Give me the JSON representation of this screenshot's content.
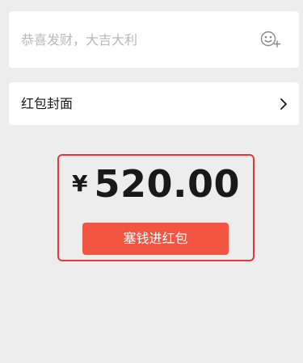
{
  "message": {
    "placeholder": "恭喜发财，大吉大利",
    "emoji_icon": "emoji-add-icon"
  },
  "cover": {
    "label": "红包封面",
    "chevron_icon": "chevron-right-icon"
  },
  "amount": {
    "currency": "¥",
    "value": "520.00"
  },
  "send_button": {
    "label": "塞钱进红包"
  },
  "colors": {
    "background": "#ededed",
    "card": "#ffffff",
    "button": "#f25542",
    "highlight_border": "#e03a40",
    "placeholder_text": "#b8b8b8",
    "primary_text": "#191919"
  }
}
